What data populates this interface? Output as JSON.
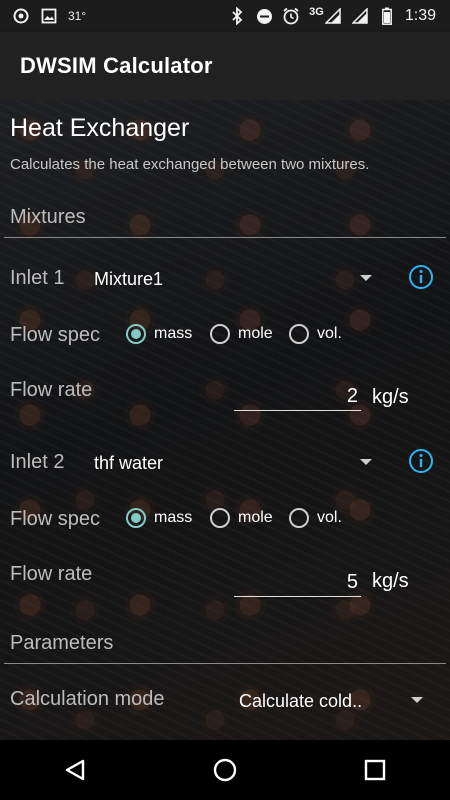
{
  "status_bar": {
    "left_temperature": "31°",
    "network": "3G",
    "time": "1:39",
    "icons": [
      "target-icon",
      "image-icon",
      "bluetooth-icon",
      "do-not-disturb-icon",
      "alarm-icon",
      "signal-icon",
      "signal-icon",
      "battery-icon"
    ]
  },
  "app_bar": {
    "title": "DWSIM Calculator"
  },
  "page": {
    "title": "Heat Exchanger",
    "subtitle": "Calculates the heat exchanged between two mixtures."
  },
  "mixtures_section": {
    "header": "Mixtures",
    "inlets": [
      {
        "label": "Inlet 1",
        "mixture": "Mixture1",
        "flow_spec_label": "Flow spec",
        "options": [
          "mass",
          "mole",
          "vol."
        ],
        "selected_option": "mass",
        "flow_rate_label": "Flow rate",
        "flow_rate_value": "2",
        "flow_rate_unit": "kg/s"
      },
      {
        "label": "Inlet 2",
        "mixture": "thf water",
        "flow_spec_label": "Flow spec",
        "options": [
          "mass",
          "mole",
          "vol."
        ],
        "selected_option": "mass",
        "flow_rate_label": "Flow rate",
        "flow_rate_value": "5",
        "flow_rate_unit": "kg/s"
      }
    ]
  },
  "parameters_section": {
    "header": "Parameters",
    "calc_mode_label": "Calculation mode",
    "calc_mode_value": "Calculate cold.."
  },
  "colors": {
    "accent_teal": "#80cbc4",
    "info_blue": "#29b6f6",
    "appbar_bg": "#212121",
    "statusbar_bg": "#1c1c1c"
  },
  "nav_bar": {
    "icons": [
      "back-icon",
      "home-icon",
      "recents-icon"
    ]
  }
}
